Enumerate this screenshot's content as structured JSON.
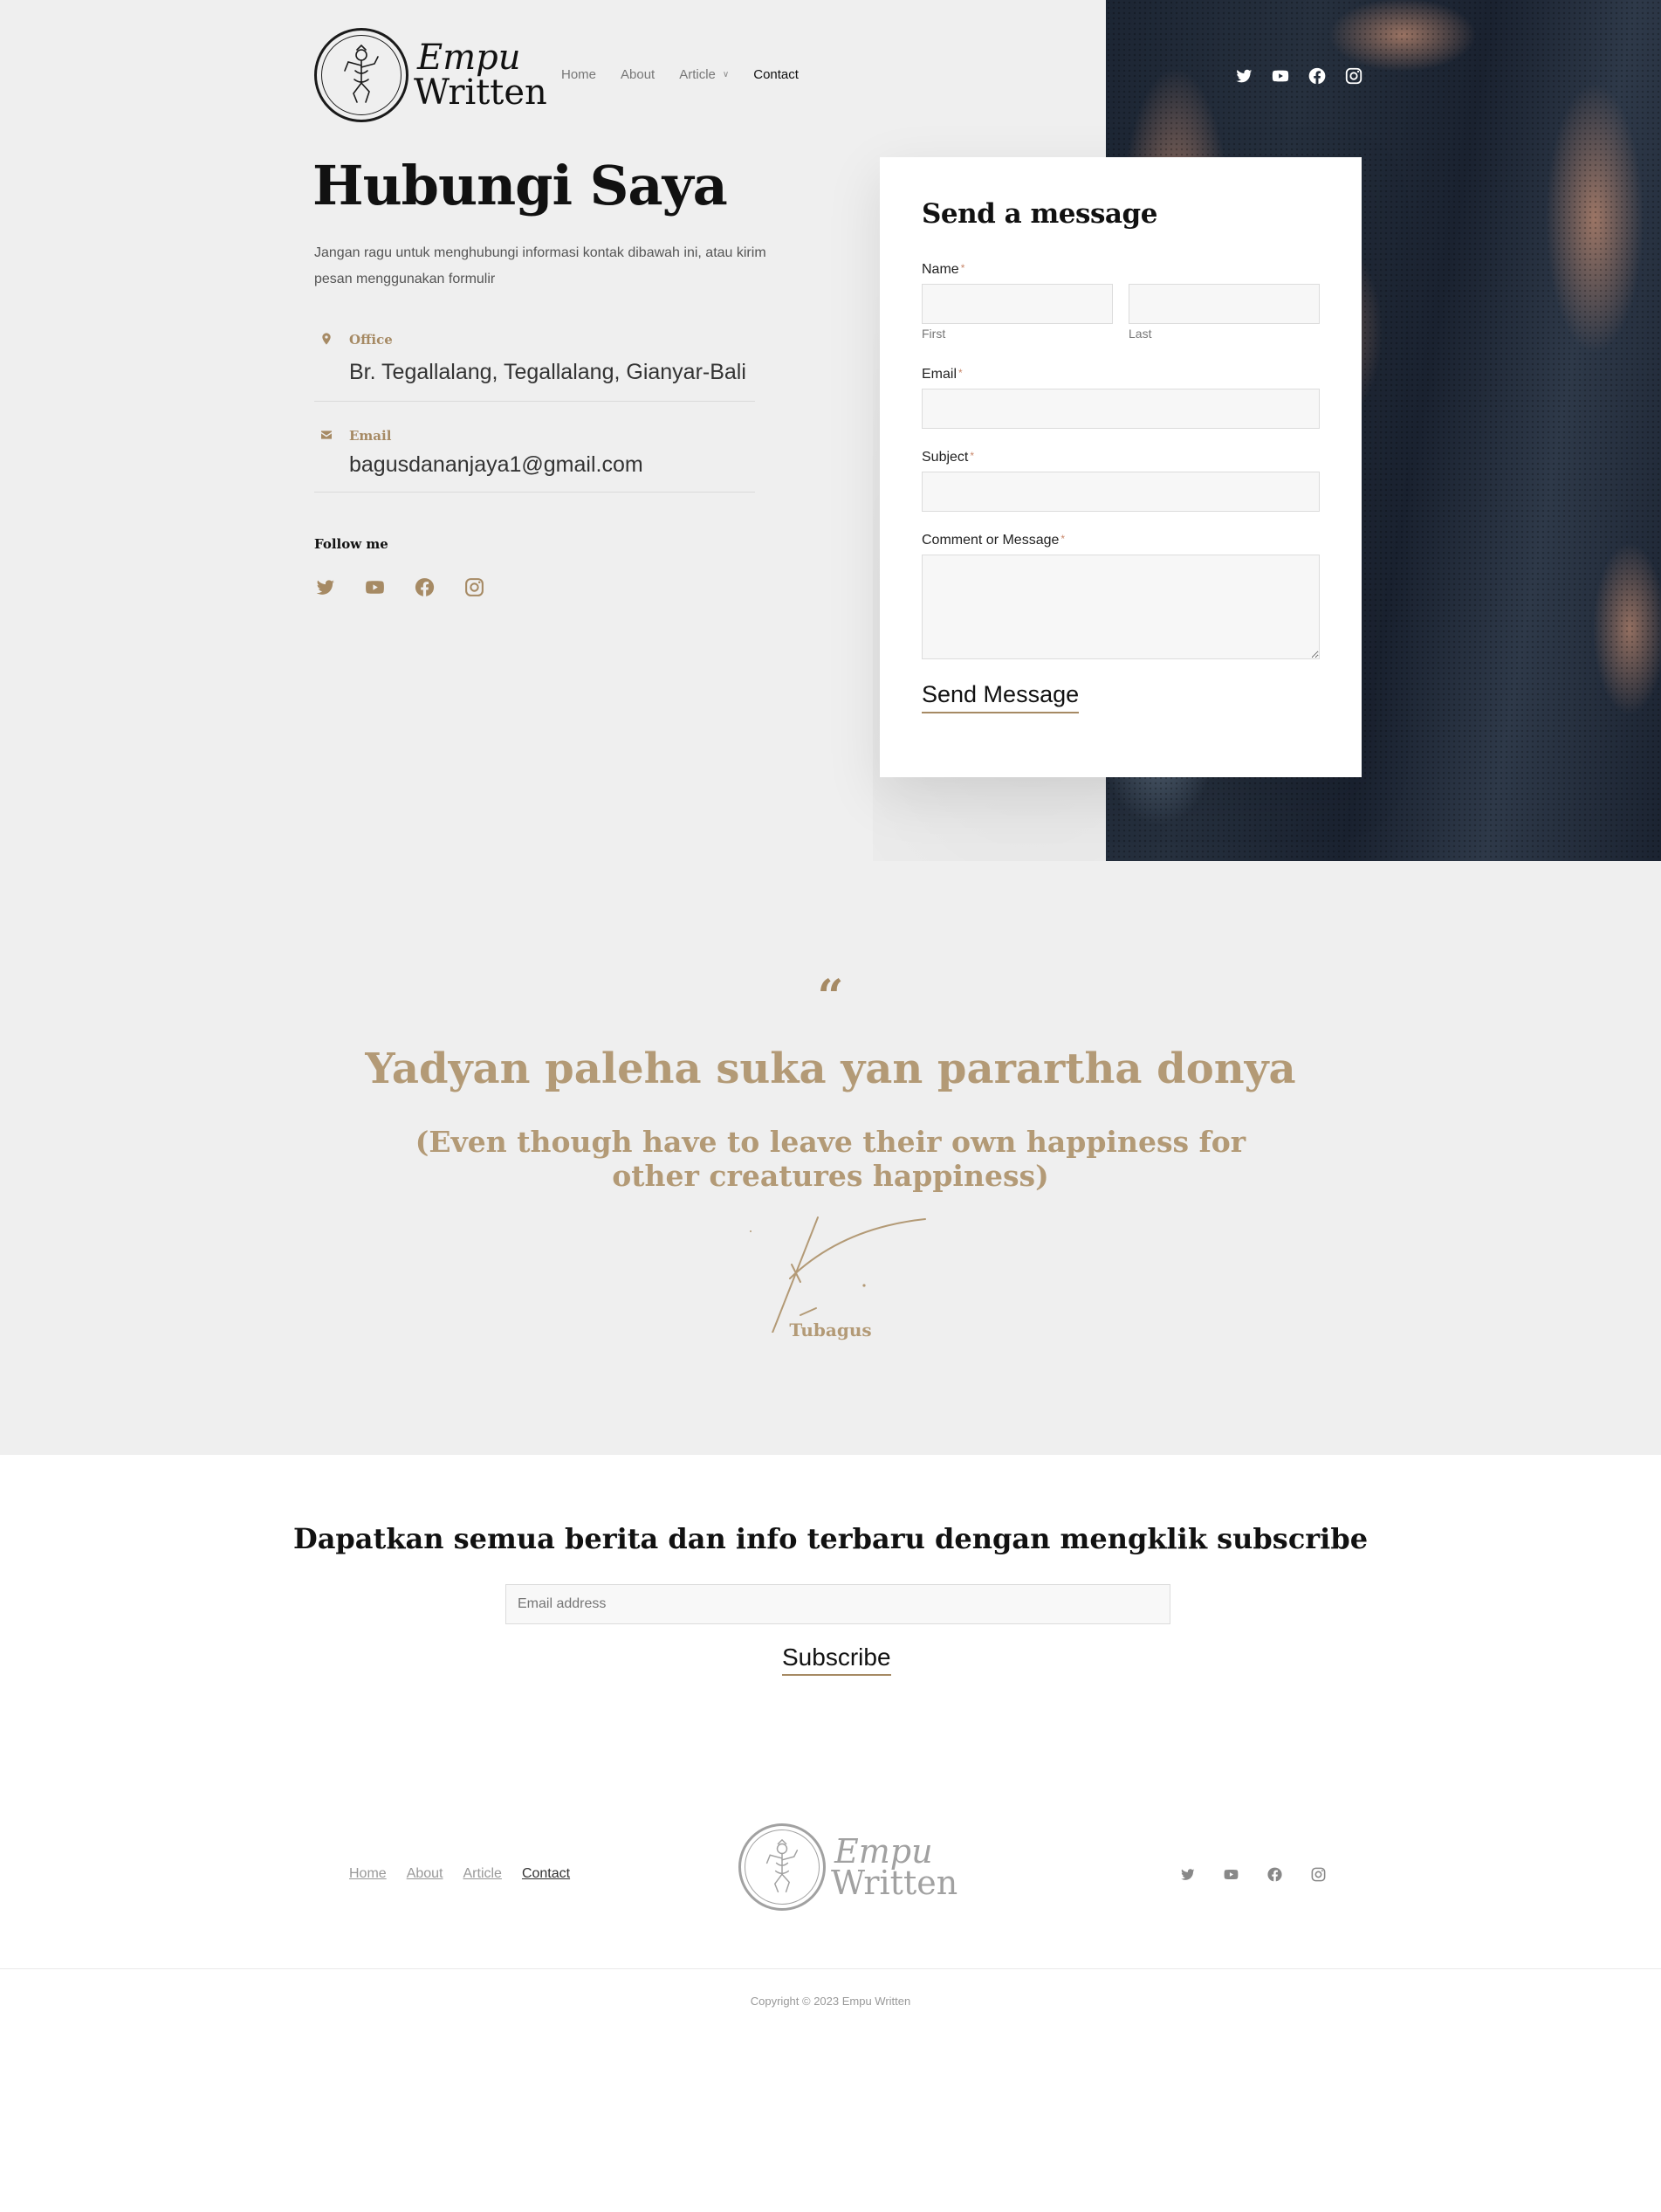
{
  "brand": {
    "line1": "Empu",
    "line2": "Written"
  },
  "nav": [
    {
      "label": "Home",
      "active": false
    },
    {
      "label": "About",
      "active": false
    },
    {
      "label": "Article",
      "active": false,
      "dropdown": true
    },
    {
      "label": "Contact",
      "active": true
    }
  ],
  "social_icons": [
    "twitter-icon",
    "youtube-icon",
    "facebook-icon",
    "instagram-icon"
  ],
  "contact": {
    "title": "Hubungi Saya",
    "description": "Jangan ragu untuk menghubungi informasi kontak dibawah ini, atau kirim pesan menggunakan formulir",
    "office_label": "Office",
    "office_value": "Br. Tegallalang, Tegallalang, Gianyar-Bali",
    "email_label": "Email",
    "email_value": "bagusdananjaya1@gmail.com",
    "follow_label": "Follow me"
  },
  "form": {
    "title": "Send a message",
    "name_label": "Name",
    "first_label": "First",
    "last_label": "Last",
    "email_label": "Email",
    "subject_label": "Subject",
    "message_label": "Comment or Message",
    "required_mark": "*",
    "submit_label": "Send Message"
  },
  "quote": {
    "mark": "“",
    "text": "Yadyan paleha suka yan parartha donya",
    "translation": "(Even though have to leave their own happiness for other creatures happiness)",
    "signature_name": "Tubagus"
  },
  "subscribe": {
    "title": "Dapatkan semua berita dan info terbaru dengan mengklik subscribe",
    "placeholder": "Email address",
    "button": "Subscribe"
  },
  "footer": {
    "nav": [
      {
        "label": "Home",
        "active": false
      },
      {
        "label": "About",
        "active": false
      },
      {
        "label": "Article",
        "active": false
      },
      {
        "label": "Contact",
        "active": true
      }
    ],
    "copyright": "Copyright © 2023 Empu Written"
  },
  "colors": {
    "accent": "#a68a64",
    "quote": "#b39a76",
    "background": "#efefef",
    "dark": "#111111"
  }
}
